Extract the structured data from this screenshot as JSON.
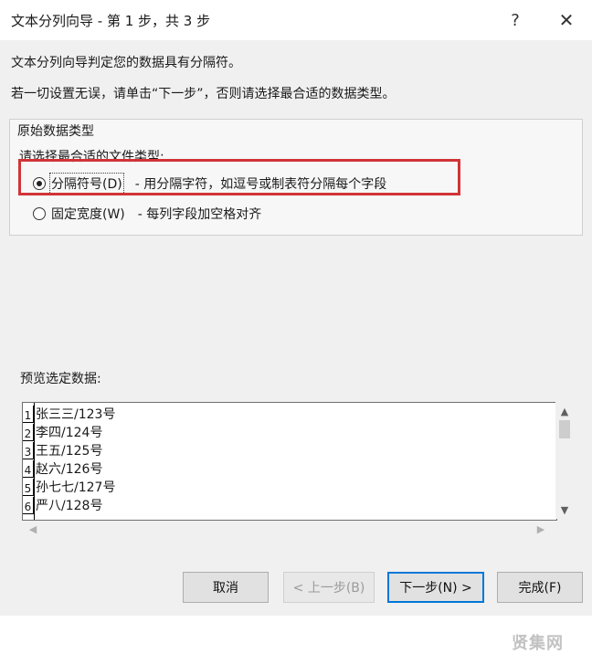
{
  "window": {
    "title": "文本分列向导 - 第 1 步，共 3 步",
    "help_glyph": "?",
    "close_glyph": "✕"
  },
  "intro": {
    "line1": "文本分列向导判定您的数据具有分隔符。",
    "line2": "若一切设置无误，请单击“下一步”，否则请选择最合适的数据类型。"
  },
  "data_type_group": {
    "title": "原始数据类型",
    "subtitle": "请选择最合适的文件类型:",
    "options": [
      {
        "label": "分隔符号(D)",
        "description": "- 用分隔字符，如逗号或制表符分隔每个字段",
        "selected": true
      },
      {
        "label": "固定宽度(W)",
        "description": "- 每列字段加空格对齐",
        "selected": false
      }
    ]
  },
  "preview": {
    "label": "预览选定数据:",
    "rows": [
      {
        "num": "1",
        "text": "张三三/123号"
      },
      {
        "num": "2",
        "text": "李四/124号"
      },
      {
        "num": "3",
        "text": "王五/125号"
      },
      {
        "num": "4",
        "text": "赵六/126号"
      },
      {
        "num": "5",
        "text": "孙七七/127号"
      },
      {
        "num": "6",
        "text": "严八/128号"
      }
    ]
  },
  "buttons": {
    "cancel": "取消",
    "back": "< 上一步(B)",
    "next": "下一步(N) >",
    "finish": "完成(F)"
  },
  "watermark": "贤集网",
  "colors": {
    "highlight_border": "#d13438",
    "default_button_border": "#0078d7"
  },
  "icons": {
    "help": "help-icon",
    "close": "close-icon",
    "scroll_up": "chevron-up-icon",
    "scroll_down": "chevron-down-icon",
    "scroll_left": "chevron-left-icon",
    "scroll_right": "chevron-right-icon"
  }
}
